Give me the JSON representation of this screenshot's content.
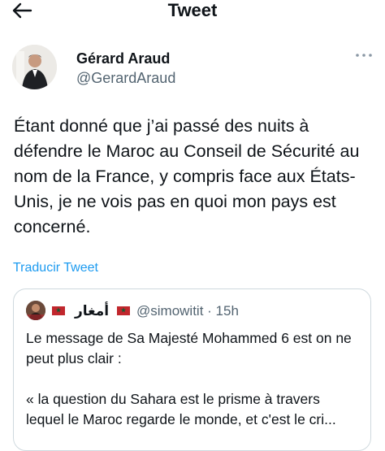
{
  "header": {
    "title": "Tweet"
  },
  "author": {
    "display_name": "Gérard Araud",
    "handle": "@GerardAraud"
  },
  "tweet": {
    "text": "Étant donné que j’ai passé des nuits à\ndéfendre le Maroc au Conseil de Sécurité au\nnom de la France, y compris face aux États-\nUnis, je ne vois pas en quoi mon pays est\nconcerné.",
    "translate_label": "Traducir Tweet"
  },
  "quote": {
    "author_name": "أمغار",
    "handle_time": "@simowitit · 15h",
    "paragraph1": "Le message de Sa Majesté Mohammed 6 est on ne peut plus clair :",
    "paragraph2": "«  la question du Sahara est le prisme à travers lequel le Maroc regarde le monde, et c'est le cri..."
  },
  "colors": {
    "link": "#1d9bf0",
    "secondary_text": "#536471",
    "border": "#cfd9de",
    "flag_red": "#c1272d",
    "flag_green": "#006233"
  },
  "icons": {
    "back": "arrow-left-icon",
    "more": "more-horizontal-icon"
  }
}
